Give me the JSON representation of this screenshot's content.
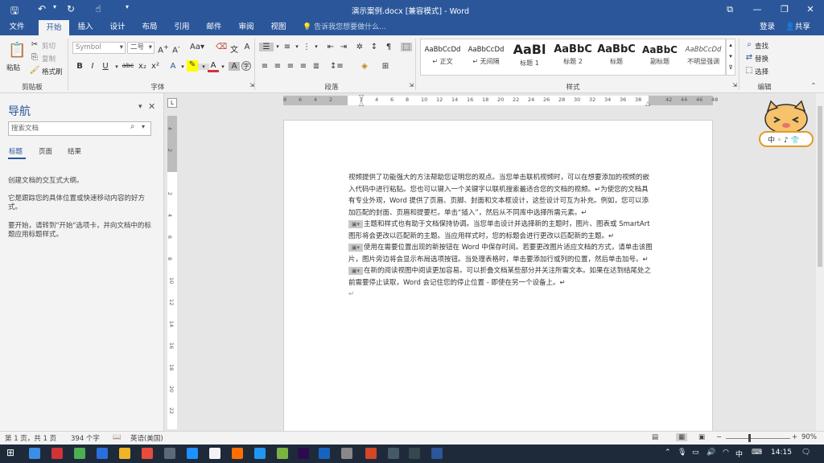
{
  "titlebar": {
    "title": "演示案例.docx [兼容模式] - Word",
    "restore_label": "⧉",
    "min_label": "—",
    "max_label": "❐",
    "close_label": "✕"
  },
  "tabs": [
    "文件",
    "开始",
    "插入",
    "设计",
    "布局",
    "引用",
    "邮件",
    "审阅",
    "视图"
  ],
  "tell_me": "告诉我您想要做什么...",
  "login": "登录",
  "share": "共享",
  "clipboard": {
    "paste": "粘贴",
    "cut": "剪切",
    "copy": "复制",
    "format_painter": "格式刷",
    "label": "剪贴板"
  },
  "font": {
    "name": "Symbol",
    "size": "二号",
    "label": "字体"
  },
  "paragraph": {
    "label": "段落"
  },
  "styles": {
    "label": "样式",
    "items": [
      {
        "preview": "AaBbCcDd",
        "name": "↵ 正文"
      },
      {
        "preview": "AaBbCcDd",
        "name": "↵ 无间隔"
      },
      {
        "preview": "AaBl",
        "name": "标题 1"
      },
      {
        "preview": "AaBbC",
        "name": "标题 2"
      },
      {
        "preview": "AaBbC",
        "name": "标题"
      },
      {
        "preview": "AaBbC",
        "name": "副标题"
      },
      {
        "preview": "AaBbCcDd",
        "name": "不明显强调"
      }
    ]
  },
  "editing": {
    "find": "查找",
    "replace": "替换",
    "select": "选择",
    "label": "编辑"
  },
  "nav": {
    "title": "导航",
    "search_placeholder": "搜索文档",
    "tabs": [
      "标题",
      "页面",
      "结果"
    ],
    "text1": "创建文档的交互式大纲。",
    "text2": "它是跟踪您的具体位置或快速移动内容的好方式。",
    "text3": "要开始，请转到\"开始\"选项卡，并向文档中的标题应用标题样式。"
  },
  "hruler_ticks": [
    "8",
    "6",
    "4",
    "2",
    "",
    "2",
    "4",
    "6",
    "8",
    "10",
    "12",
    "14",
    "16",
    "18",
    "20",
    "22",
    "24",
    "26",
    "28",
    "30",
    "32",
    "34",
    "36",
    "38",
    "",
    "42",
    "44",
    "46",
    "48"
  ],
  "vruler_ticks": [
    "4",
    "2",
    "",
    "2",
    "4",
    "6",
    "8",
    "10",
    "12",
    "14",
    "16",
    "18",
    "20",
    "22"
  ],
  "document": {
    "p1": "视频提供了功能强大的方法帮助您证明您的观点。当您单击联机视频时，可以在想要添加的视频的嵌入代码中进行粘贴。您也可以键入一个关键字以联机搜索最适合您的文档的视频。↵为使您的文档具有专业外观，Word 提供了页眉、页脚、封面和文本框设计，这些设计可互为补充。例如，您可以添加匹配的封面、页眉和提要栏。单击“插入”，然后从不同库中选择所需元素。↵",
    "p2": "主题和样式也有助于文档保持协调。当您单击设计并选择新的主题时，图片、图表或 SmartArt 图形将会更改以匹配新的主题。当应用样式时，您的标题会进行更改以匹配新的主题。↵",
    "p3": "使用在需要位置出现的新按钮在 Word 中保存时间。若要更改图片适应文档的方式，请单击该图片，图片旁边将会显示布局选项按钮。当处理表格时，单击要添加行或列的位置，然后单击加号。↵",
    "p4": "在新的阅读视图中阅读更加容易。可以折叠文档某些部分并关注所需文本。如果在达到结尾处之前需要停止读取，Word 会记住您的停止位置 - 即使在另一个设备上。↵",
    "p5": "↵"
  },
  "mascot_text": "中 ◦ ♪ 👕",
  "status": {
    "page": "第 1 页，共 1 页",
    "words": "394 个字",
    "lang": "英语(美国)",
    "zoom": "90%"
  },
  "taskbar": {
    "time": "14:15",
    "ime": "中"
  },
  "colors": {
    "brand": "#2b579a",
    "accent_red": "#d13438",
    "highlight": "#ffff00"
  }
}
